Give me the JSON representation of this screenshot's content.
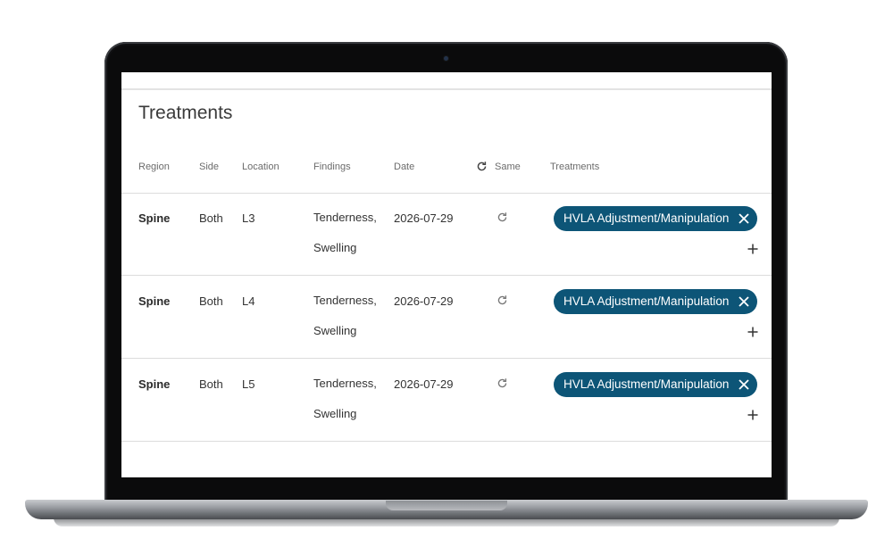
{
  "page": {
    "title": "Treatments"
  },
  "table": {
    "headers": {
      "region": "Region",
      "side": "Side",
      "location": "Location",
      "findings": "Findings",
      "date": "Date",
      "same": "Same",
      "treatments": "Treatments"
    },
    "rows": [
      {
        "region": "Spine",
        "side": "Both",
        "location": "L3",
        "findings_line1": "Tenderness,",
        "findings_line2": "Swelling",
        "date": "2026-07-29",
        "treatment": "HVLA Adjustment/Manipulation"
      },
      {
        "region": "Spine",
        "side": "Both",
        "location": "L4",
        "findings_line1": "Tenderness,",
        "findings_line2": "Swelling",
        "date": "2026-07-29",
        "treatment": "HVLA Adjustment/Manipulation"
      },
      {
        "region": "Spine",
        "side": "Both",
        "location": "L5",
        "findings_line1": "Tenderness,",
        "findings_line2": "Swelling",
        "date": "2026-07-29",
        "treatment": "HVLA Adjustment/Manipulation"
      }
    ]
  },
  "icons": {
    "same_header": "refresh-icon",
    "row_same": "refresh-icon",
    "chip_remove": "close-icon",
    "add_treatment": "plus-icon"
  },
  "colors": {
    "chip_background": "#0d5577",
    "chip_text": "#ffffff",
    "divider": "#dcdcdc"
  }
}
